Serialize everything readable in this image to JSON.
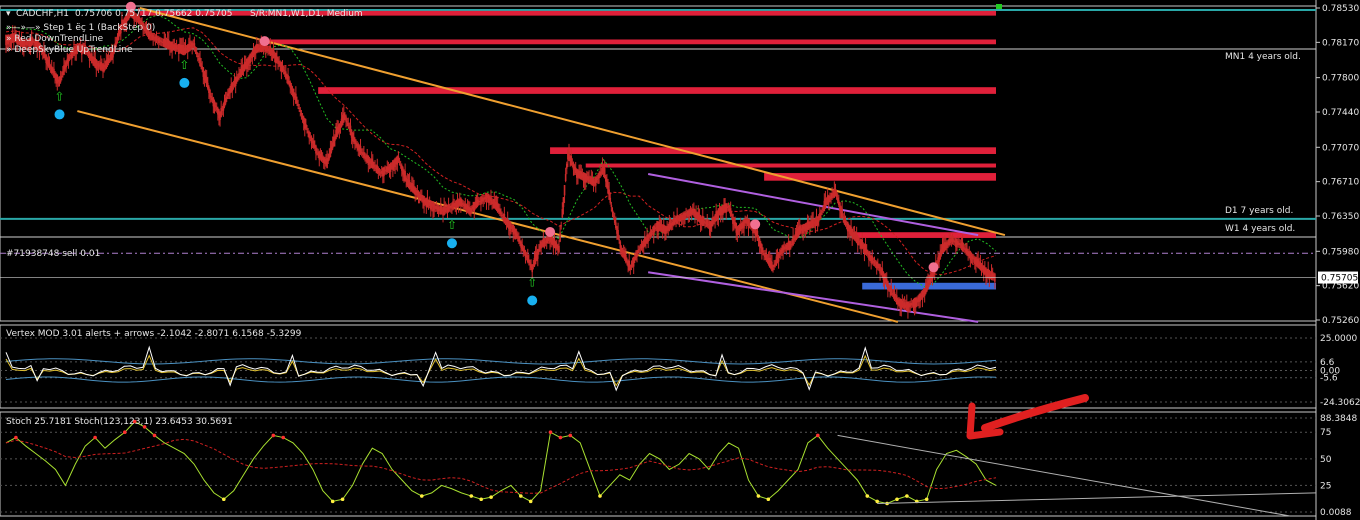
{
  "header": {
    "symbol": "CADCHF,H1",
    "ohlc": "0.75706 0.75717 0.75662 0.75705",
    "sr": "S/R:MN1,W1,D1, Medium",
    "items": [
      "»—»—» Step 1 ëç 1 (BackStep 0)",
      "» Red DownTrendLine",
      "» DeepSkyBlue UpTrendLine"
    ]
  },
  "labels": {
    "mn1": "MN1 4 years old.",
    "d1": "D1 7 years old.",
    "w1": "W1 4 years old.",
    "order": "#71938748 sell 0.01"
  },
  "indicators": {
    "vertex_title": "Vertex MOD 3.01 alerts + arrows -2.1042 -2.8071 6.1568 -5.3299",
    "stoch_title": "Stoch 25.7181  Stoch(123,123,1) 23.6453 30.5691"
  },
  "colors": {
    "background": "#000000",
    "candle": "#cc2b2b",
    "resistance_zone": "#e0203a",
    "support_zone": "#3a6ad8",
    "channel": "#f0a030",
    "purple_line": "#b060e0",
    "teal_line": "#2aa8a8",
    "ma_red": "#d02020",
    "ma_green": "#22bb22",
    "stoch": "#a8e030",
    "arrow": "#e02020",
    "dot_blue": "#18b0f0",
    "dot_pink": "#f07090"
  },
  "chart_data": {
    "type": "candlestick",
    "symbol": "CADCHF",
    "timeframe": "H1",
    "ylim": [
      0.7526,
      0.7853
    ],
    "price_ticks": [
      "0.78530",
      "0.78170",
      "0.77800",
      "0.77440",
      "0.77070",
      "0.76710",
      "0.76350",
      "0.75980",
      "0.75620",
      "0.75260"
    ],
    "current_price": "0.75705",
    "close_path": [
      0.782,
      0.7822,
      0.7815,
      0.7818,
      0.781,
      0.779,
      0.7775,
      0.78,
      0.7812,
      0.7808,
      0.7795,
      0.779,
      0.7805,
      0.7835,
      0.7848,
      0.784,
      0.7825,
      0.782,
      0.7815,
      0.7812,
      0.7808,
      0.7815,
      0.779,
      0.776,
      0.774,
      0.7765,
      0.778,
      0.7795,
      0.781,
      0.7812,
      0.7805,
      0.779,
      0.777,
      0.7745,
      0.772,
      0.77,
      0.769,
      0.772,
      0.774,
      0.7715,
      0.77,
      0.769,
      0.768,
      0.7685,
      0.7695,
      0.767,
      0.766,
      0.765,
      0.7645,
      0.764,
      0.7645,
      0.765,
      0.764,
      0.765,
      0.7655,
      0.7645,
      0.763,
      0.762,
      0.76,
      0.758,
      0.7605,
      0.7612,
      0.76,
      0.77,
      0.768,
      0.7675,
      0.767,
      0.7685,
      0.764,
      0.76,
      0.758,
      0.76,
      0.7612,
      0.7625,
      0.762,
      0.763,
      0.7635,
      0.764,
      0.763,
      0.7625,
      0.764,
      0.7645,
      0.762,
      0.763,
      0.762,
      0.7595,
      0.758,
      0.76,
      0.7605,
      0.762,
      0.7625,
      0.763,
      0.765,
      0.766,
      0.763,
      0.7615,
      0.7605,
      0.759,
      0.758,
      0.756,
      0.7545,
      0.754,
      0.7545,
      0.7555,
      0.7575,
      0.76,
      0.761,
      0.7605,
      0.7595,
      0.7585,
      0.7575,
      0.757
    ],
    "resistance_zones": [
      {
        "from_index": 15,
        "price_top": 0.785,
        "price_bottom": 0.7845
      },
      {
        "from_index": 29,
        "price_top": 0.782,
        "price_bottom": 0.7815
      },
      {
        "from_index": 35,
        "price_top": 0.777,
        "price_bottom": 0.7763
      },
      {
        "from_index": 61,
        "price_top": 0.7707,
        "price_bottom": 0.77
      },
      {
        "from_index": 65,
        "price_top": 0.769,
        "price_bottom": 0.7686
      },
      {
        "from_index": 85,
        "price_top": 0.768,
        "price_bottom": 0.7672
      },
      {
        "from_index": 95,
        "price_top": 0.7618,
        "price_bottom": 0.7612
      }
    ],
    "support_zones": [
      {
        "from_index": 96,
        "price_top": 0.7565,
        "price_bottom": 0.7558
      }
    ],
    "horizontal_lines": [
      {
        "label": "MN1 4 years old.",
        "price": 0.781
      },
      {
        "label": "D1 7 years old.",
        "price": 0.7632
      },
      {
        "label": "W1 4 years old.",
        "price": 0.7613
      },
      {
        "label": "#71938748 sell 0.01",
        "price": 0.7596
      }
    ],
    "channel_upper": [
      [
        15,
        0.7853
      ],
      [
        112,
        0.7615
      ]
    ],
    "channel_lower": [
      [
        8,
        0.7745
      ],
      [
        100,
        0.7524
      ]
    ],
    "purple_upper": [
      [
        72,
        0.7679
      ],
      [
        109,
        0.7615
      ]
    ],
    "purple_lower": [
      [
        72,
        0.7576
      ],
      [
        109,
        0.7524
      ]
    ],
    "up_arrows_index": [
      6,
      20,
      50,
      59
    ],
    "vertex": {
      "ticks": [
        "25.0000",
        "6.6",
        "0.00",
        "-5.6",
        "-24.3062"
      ],
      "values": [
        -2.1042,
        -2.8071,
        6.1568,
        -5.3299
      ]
    },
    "stoch": {
      "ticks": [
        "88.3848",
        "75",
        "50",
        "25",
        "0.0088"
      ],
      "values": [
        25.7181,
        23.6453,
        30.5691
      ],
      "path": [
        65,
        70,
        62,
        55,
        48,
        40,
        25,
        45,
        62,
        70,
        60,
        68,
        75,
        85,
        80,
        72,
        65,
        60,
        55,
        45,
        30,
        18,
        12,
        20,
        35,
        50,
        62,
        72,
        70,
        65,
        55,
        40,
        20,
        10,
        12,
        25,
        45,
        60,
        55,
        40,
        30,
        20,
        15,
        18,
        25,
        22,
        18,
        15,
        12,
        14,
        20,
        25,
        15,
        10,
        20,
        75,
        70,
        72,
        65,
        40,
        15,
        25,
        35,
        30,
        45,
        55,
        50,
        40,
        45,
        55,
        50,
        40,
        55,
        65,
        60,
        30,
        15,
        12,
        20,
        30,
        40,
        65,
        72,
        60,
        50,
        40,
        30,
        15,
        10,
        8,
        12,
        15,
        10,
        12,
        40,
        55,
        58,
        52,
        45,
        30,
        25
      ]
    }
  }
}
